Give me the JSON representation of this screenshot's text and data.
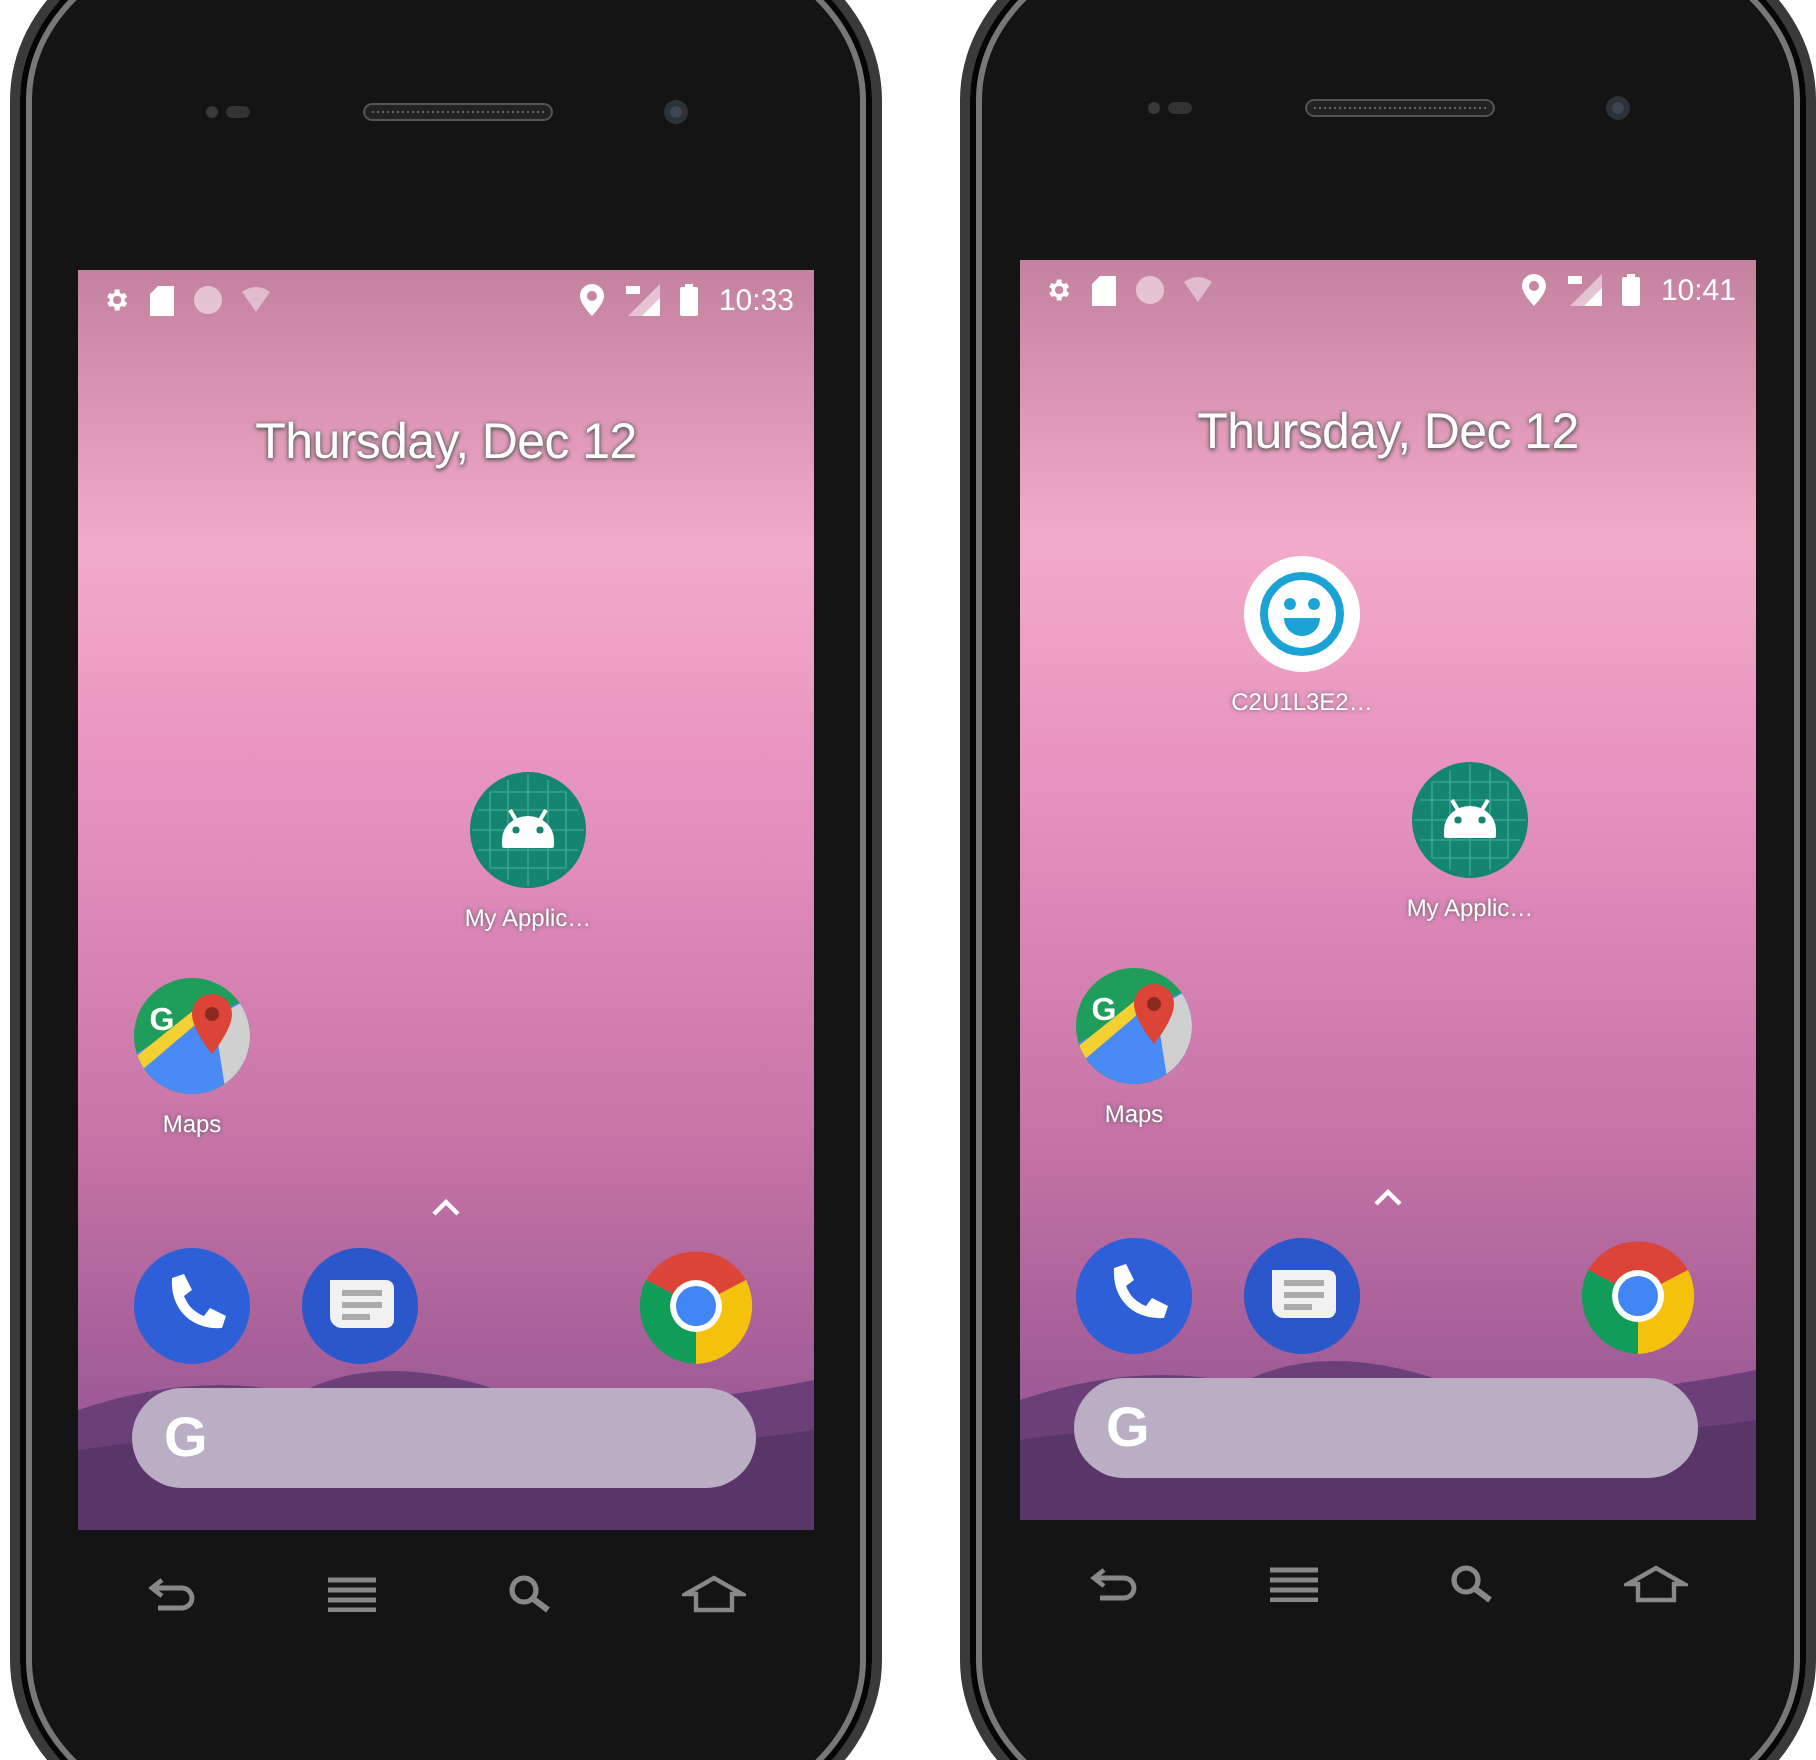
{
  "phones": [
    {
      "status_bar": {
        "time": "10:33"
      },
      "date": "Thursday, Dec 12",
      "apps": [
        {
          "kind": "android",
          "label": "My Applic…"
        },
        {
          "kind": "maps",
          "label": "Maps",
          "icon_text": "G"
        }
      ],
      "dock": [
        {
          "kind": "phone"
        },
        {
          "kind": "messages"
        },
        {
          "kind": "chrome"
        }
      ],
      "search_bar": {
        "logo": "G"
      }
    },
    {
      "status_bar": {
        "time": "10:41"
      },
      "date": "Thursday, Dec 12",
      "apps": [
        {
          "kind": "smiley",
          "label": "C2U1L3E2…"
        },
        {
          "kind": "android",
          "label": "My Applic…"
        },
        {
          "kind": "maps",
          "label": "Maps",
          "icon_text": "G"
        }
      ],
      "dock": [
        {
          "kind": "phone"
        },
        {
          "kind": "messages"
        },
        {
          "kind": "chrome"
        }
      ],
      "search_bar": {
        "logo": "G"
      }
    }
  ]
}
